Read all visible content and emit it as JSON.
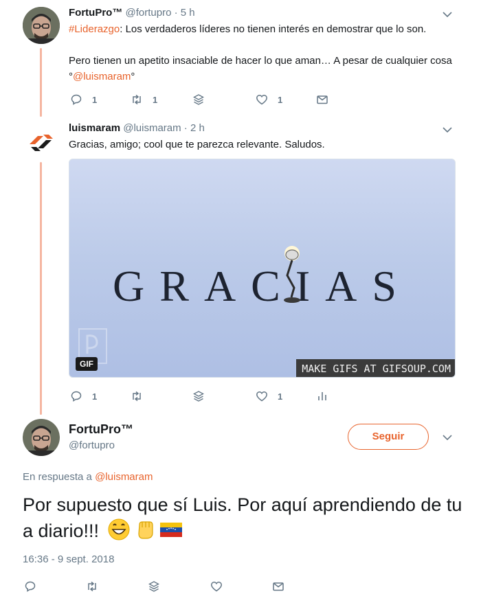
{
  "tweet1": {
    "name": "FortuPro™",
    "handle": "@fortupro",
    "sep": "·",
    "time": "5 h",
    "hashtag": "#Liderazgo",
    "text1": ": Los verdaderos líderes no tienen interés en demostrar que lo son.",
    "text2": "Pero tienen un apetito insaciable de hacer lo que aman… A pesar de cualquier cosa °",
    "mention": "@luismaram",
    "text3": "°",
    "reply_count": "1",
    "retweet_count": "1",
    "like_count": "1"
  },
  "tweet2": {
    "name": "luismaram",
    "handle": "@luismaram",
    "sep": "·",
    "time": "2 h",
    "text": "Gracias, amigo; cool que te parezca relevante. Saludos.",
    "gif_word": "GRACIAS",
    "gif_badge": "GIF",
    "gif_banner": "MAKE GIFS AT GIFSOUP.COM",
    "reply_count": "1",
    "like_count": "1"
  },
  "main_tweet": {
    "name": "FortuPro™",
    "handle": "@fortupro",
    "follow_label": "Seguir",
    "reply_prefix": "En respuesta a ",
    "reply_mention": "@luismaram",
    "text": "Por supuesto que sí Luis. Por aquí aprendiendo de tu a diario!!!",
    "timestamp": "16:36 - 9 sept. 2018"
  },
  "icons": {
    "reply": "reply-icon",
    "retweet": "retweet-icon",
    "stack": "layers-icon",
    "like": "heart-icon",
    "dm": "envelope-icon",
    "analytics": "analytics-icon",
    "more": "chevron-down-icon"
  },
  "colors": {
    "accent": "#e8632c",
    "thread_line": "#f5b6a1",
    "muted": "#657786",
    "text": "#14171a"
  }
}
